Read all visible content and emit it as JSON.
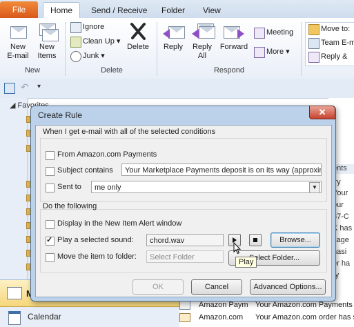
{
  "ribbon": {
    "file_tab": "File",
    "tabs": [
      "Home",
      "Send / Receive",
      "Folder",
      "View"
    ],
    "new_group": {
      "label": "New",
      "new_email": "New\nE-mail",
      "new_items": "New\nItems"
    },
    "delete_group": {
      "label": "Delete",
      "ignore": "Ignore",
      "clean_up": "Clean Up",
      "junk": "Junk",
      "delete": "Delete"
    },
    "respond_group": {
      "label": "Respond",
      "reply": "Reply",
      "reply_all": "Reply\nAll",
      "forward": "Forward",
      "meeting": "Meeting",
      "more": "More"
    },
    "quick_steps": {
      "move_to": "Move to:",
      "team_email": "Team E-m",
      "reply_delete": "Reply &"
    }
  },
  "nav": {
    "favorites": "Favorites",
    "calendar": "Calendar",
    "mail_letter": "M"
  },
  "background_list": {
    "header_fragment": "ents",
    "row_fragments": [
      "iry",
      "Your",
      "our",
      "37-C",
      "K has",
      "kage",
      "hasi",
      "er ha",
      "ry"
    ],
    "rows": [
      {
        "from": "Amazon Paym",
        "subject": "Your Amazon.com Payments depo"
      },
      {
        "from": "Amazon.com",
        "subject": "Your Amazon.com order has shipp"
      }
    ]
  },
  "dialog": {
    "title": "Create Rule",
    "close": "✕",
    "conditions_legend": "When I get e-mail with all of the selected conditions",
    "from_label": "From Amazon.com Payments",
    "from_checked": false,
    "subject_label": "Subject contains",
    "subject_checked": false,
    "subject_value": "Your Marketplace Payments deposit is on its way (approxim",
    "sent_to_label": "Sent to",
    "sent_to_checked": false,
    "sent_to_value": "me only",
    "actions_legend": "Do the following",
    "alert_label": "Display in the New Item Alert window",
    "alert_checked": false,
    "sound_label": "Play a selected sound:",
    "sound_checked": true,
    "sound_value": "chord.wav",
    "browse": "Browse...",
    "move_label": "Move the item to folder:",
    "move_checked": false,
    "move_placeholder": "Select Folder",
    "select_folder": "Select Folder...",
    "play_tooltip": "Play",
    "ok": "OK",
    "cancel": "Cancel",
    "advanced": "Advanced Options..."
  },
  "colors": {
    "accent": "#d9581b",
    "ribbon_bg": "#e9eff8",
    "dialog_frame": "#bcd2ea"
  }
}
